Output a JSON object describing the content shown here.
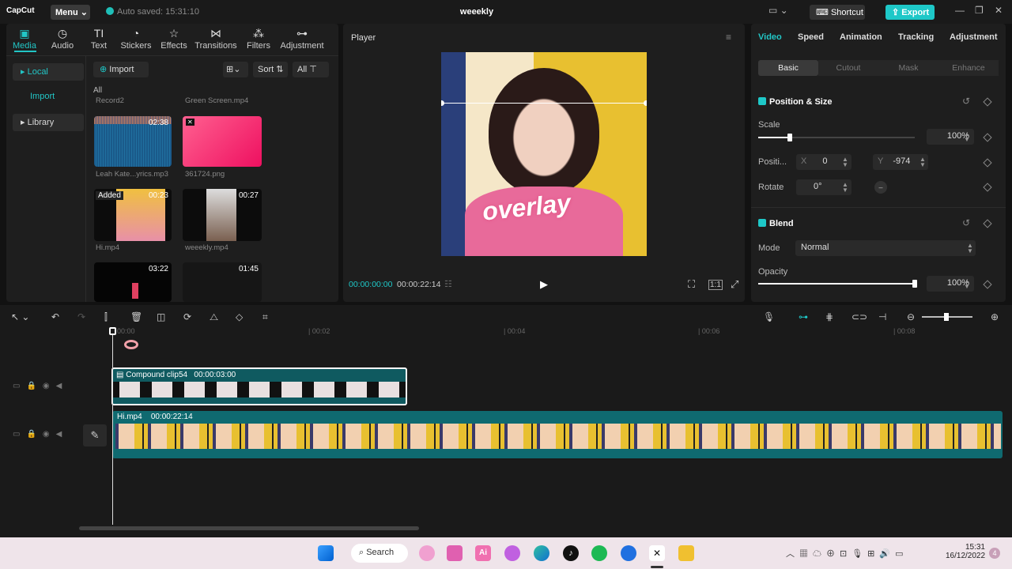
{
  "app": {
    "logo": "CapCut",
    "menu": "Menu ⌄",
    "autosave": "Auto saved: 15:31:10",
    "title": "weeekly",
    "shortcut": "Shortcut",
    "export": "Export"
  },
  "media_tabs": [
    "Media",
    "Audio",
    "Text",
    "Stickers",
    "Effects",
    "Transitions",
    "Filters",
    "Adjustment"
  ],
  "media_tab_icons": [
    "media-icon",
    "audio-icon",
    "text-icon",
    "stickers-icon",
    "effects-icon",
    "transitions-icon",
    "filters-icon",
    "adjustment-icon"
  ],
  "sidebar": {
    "local": "Local",
    "import": "Import",
    "library": "Library"
  },
  "media_toolbar": {
    "import": "Import",
    "sort": "Sort",
    "all": "All"
  },
  "media_all_label": "All",
  "media_items": [
    {
      "name": "Record2",
      "dur": "",
      "color": "#1f1f1f"
    },
    {
      "name": "Green Screen.mp4",
      "dur": "",
      "color": "#1f1f1f"
    },
    {
      "name": "Leah Kate...yrics.mp3",
      "dur": "02:38",
      "color": "#1a5a8a"
    },
    {
      "name": "361724.png",
      "dur": "",
      "color": "#ee3a78"
    },
    {
      "name": "Hi.mp4",
      "dur": "00:23",
      "badge": "Added",
      "color": "#e8b040"
    },
    {
      "name": "weeekly.mp4",
      "dur": "00:27",
      "color": "#6a5a4a"
    },
    {
      "name": "",
      "dur": "03:22",
      "color": "#0a0a0a"
    },
    {
      "name": "",
      "dur": "01:45",
      "color": "#151515"
    }
  ],
  "player": {
    "title": "Player",
    "current": "00:00:00:00",
    "total": "00:00:22:14",
    "overlay": "overlay"
  },
  "props": {
    "tabs": [
      "Video",
      "Speed",
      "Animation",
      "Tracking",
      "Adjustment"
    ],
    "subtabs": [
      "Basic",
      "Cutout",
      "Mask",
      "Enhance"
    ],
    "pos_size": "Position & Size",
    "scale_label": "Scale",
    "scale_val": "100%",
    "scale_fraction": 0.2,
    "position_label": "Positi...",
    "x_label": "X",
    "x_val": "0",
    "y_label": "Y",
    "y_val": "-974",
    "rotate_label": "Rotate",
    "rotate_val": "0°",
    "blend": "Blend",
    "mode_label": "Mode",
    "mode_val": "Normal",
    "opacity_label": "Opacity",
    "opacity_val": "100%",
    "opacity_fraction": 1.0
  },
  "timeline": {
    "ticks": [
      "00:00",
      "00:02",
      "00:04",
      "00:06",
      "00:08"
    ],
    "compound": {
      "name": "Compound clip54",
      "dur": "00:00:03:00"
    },
    "main": {
      "name": "Hi.mp4",
      "dur": "00:00:22:14"
    }
  },
  "taskbar": {
    "search": "Search",
    "time": "15:31",
    "date": "16/12/2022",
    "notif": "4"
  }
}
